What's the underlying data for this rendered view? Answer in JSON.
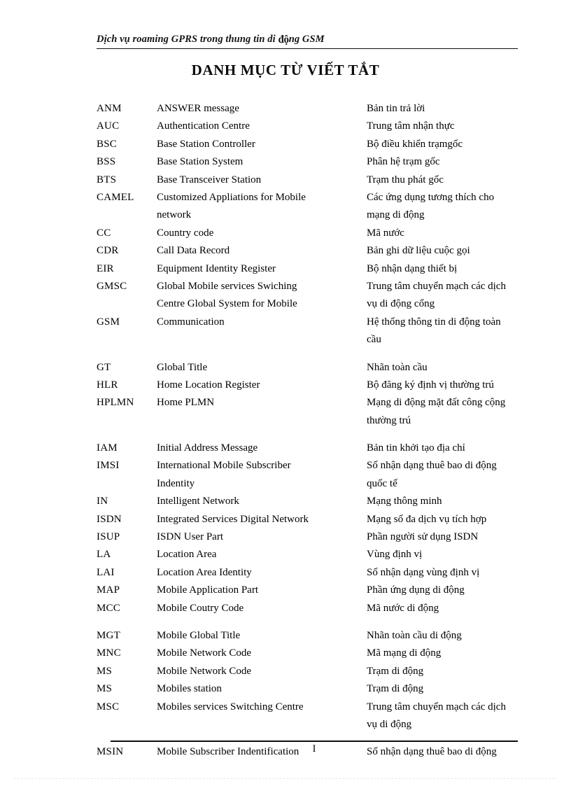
{
  "header": {
    "running_title_part1": "Dịch vụ roaming GPRS trong thung tin di ",
    "running_title_bump": "độ",
    "running_title_part2": "ng GSM"
  },
  "title": "DANH MỤC TỪ VIẾT TẮT",
  "footer": {
    "page_number": "I"
  },
  "abbreviations": [
    {
      "abbr": "ANM",
      "en": "ANSWER message",
      "en_cont": "",
      "vi": "Bản tin trả lời",
      "vi_cont": ""
    },
    {
      "abbr": "AUC",
      "en": "Authentication Centre",
      "en_cont": "",
      "vi": "Trung tâm nhận thực",
      "vi_cont": ""
    },
    {
      "abbr": "BSC",
      "en": "Base Station Controller",
      "en_cont": "",
      "vi": "Bộ điều khiển trạmgốc",
      "vi_cont": ""
    },
    {
      "abbr": "BSS",
      "en": "Base Station System",
      "en_cont": "",
      "vi": "Phân hệ trạm gốc",
      "vi_cont": ""
    },
    {
      "abbr": "BTS",
      "en": "Base Transceiver Station",
      "en_cont": "",
      "vi": "Trạm thu phát gốc",
      "vi_cont": ""
    },
    {
      "abbr": "CAMEL",
      "en": "Customized Appliations for Mobile",
      "en_cont": "network",
      "vi": "Các ứng dụng tương thích cho",
      "vi_cont": "mạng di động"
    },
    {
      "abbr": "CC",
      "en": "Country code",
      "en_cont": "",
      "vi": "Mã nước",
      "vi_cont": ""
    },
    {
      "abbr": "CDR",
      "en": "Call Data Record",
      "en_cont": "",
      "vi": "Bản ghi dữ liệu cuộc gọi",
      "vi_cont": ""
    },
    {
      "abbr": "EIR",
      "en": "Equipment Identity Register",
      "en_cont": "",
      "vi": "Bộ nhận dạng thiết bị",
      "vi_cont": ""
    },
    {
      "abbr": "GMSC",
      "en": "Global Mobile services Swiching",
      "en_cont": "Centre Global System for Mobile",
      "vi": "Trung tâm chuyển mạch các dịch",
      "vi_cont": "vụ di động cổng"
    },
    {
      "abbr": "GSM",
      "en": "Communication",
      "en_cont": "",
      "vi": "Hệ thống thông tin di động toàn",
      "vi_cont": "cầu"
    },
    {
      "abbr": "GT",
      "en": "Global Title",
      "en_cont": "",
      "vi": "Nhãn toàn cầu",
      "vi_cont": ""
    },
    {
      "abbr": "HLR",
      "en": "Home Location Register",
      "en_cont": "",
      "vi": "Bộ đăng ký định vị thường trú",
      "vi_cont": ""
    },
    {
      "abbr": "HPLMN",
      "en": "Home PLMN",
      "en_cont": "",
      "vi": "Mạng di động mặt đất công cộng",
      "vi_cont": "thường trú"
    },
    {
      "abbr": "IAM",
      "en": "Initial Address Message",
      "en_cont": "",
      "vi": "Bản tin khởi tạo địa chỉ",
      "vi_cont": ""
    },
    {
      "abbr": "IMSI",
      "en": "International Mobile Subscriber",
      "en_cont": "Indentity",
      "vi": "Số nhận dạng thuê bao di động",
      "vi_cont": "quốc tế"
    },
    {
      "abbr": "IN",
      "en": "Intelligent Network",
      "en_cont": "",
      "vi": "Mạng thông minh",
      "vi_cont": ""
    },
    {
      "abbr": "ISDN",
      "en": "Integrated Services Digital Network",
      "en_cont": "",
      "vi": "Mạng số đa dịch vụ tích hợp",
      "vi_cont": ""
    },
    {
      "abbr": "ISUP",
      "en": "ISDN User Part",
      "en_cont": "",
      "vi": "Phần người sử dụng ISDN",
      "vi_cont": ""
    },
    {
      "abbr": "LA",
      "en": "Location Area",
      "en_cont": "",
      "vi": "Vùng định vị",
      "vi_cont": ""
    },
    {
      "abbr": "LAI",
      "en": "Location Area Identity",
      "en_cont": "",
      "vi": "Số nhận dạng vùng định vị",
      "vi_cont": ""
    },
    {
      "abbr": "MAP",
      "en": "Mobile Application Part",
      "en_cont": "",
      "vi": "Phần ứng dụng di động",
      "vi_cont": ""
    },
    {
      "abbr": "MCC",
      "en": "Mobile Coutry Code",
      "en_cont": "",
      "vi": "Mã nước di động",
      "vi_cont": ""
    },
    {
      "abbr": "MGT",
      "en": "Mobile Global Title",
      "en_cont": "",
      "vi": "Nhãn toàn cầu di động",
      "vi_cont": ""
    },
    {
      "abbr": "MNC",
      "en": "Mobile Network Code",
      "en_cont": "",
      "vi": "Mã mạng di động",
      "vi_cont": ""
    },
    {
      "abbr": "MS",
      "en": "Mobile Network Code",
      "en_cont": "",
      "vi": "Trạm di động",
      "vi_cont": ""
    },
    {
      "abbr": "MS",
      "en": "Mobiles station",
      "en_cont": "",
      "vi": "Trạm di động",
      "vi_cont": ""
    },
    {
      "abbr": "MSC",
      "en": "Mobiles services Switching Centre",
      "en_cont": "",
      "vi": "Trung tâm chuyển mạch các dịch",
      "vi_cont": "vụ di động"
    },
    {
      "abbr": "MSIN",
      "en": "Mobile Subscriber Indentification",
      "en_cont": "",
      "vi": "Số nhận dạng thuê bao di động",
      "vi_cont": ""
    }
  ]
}
